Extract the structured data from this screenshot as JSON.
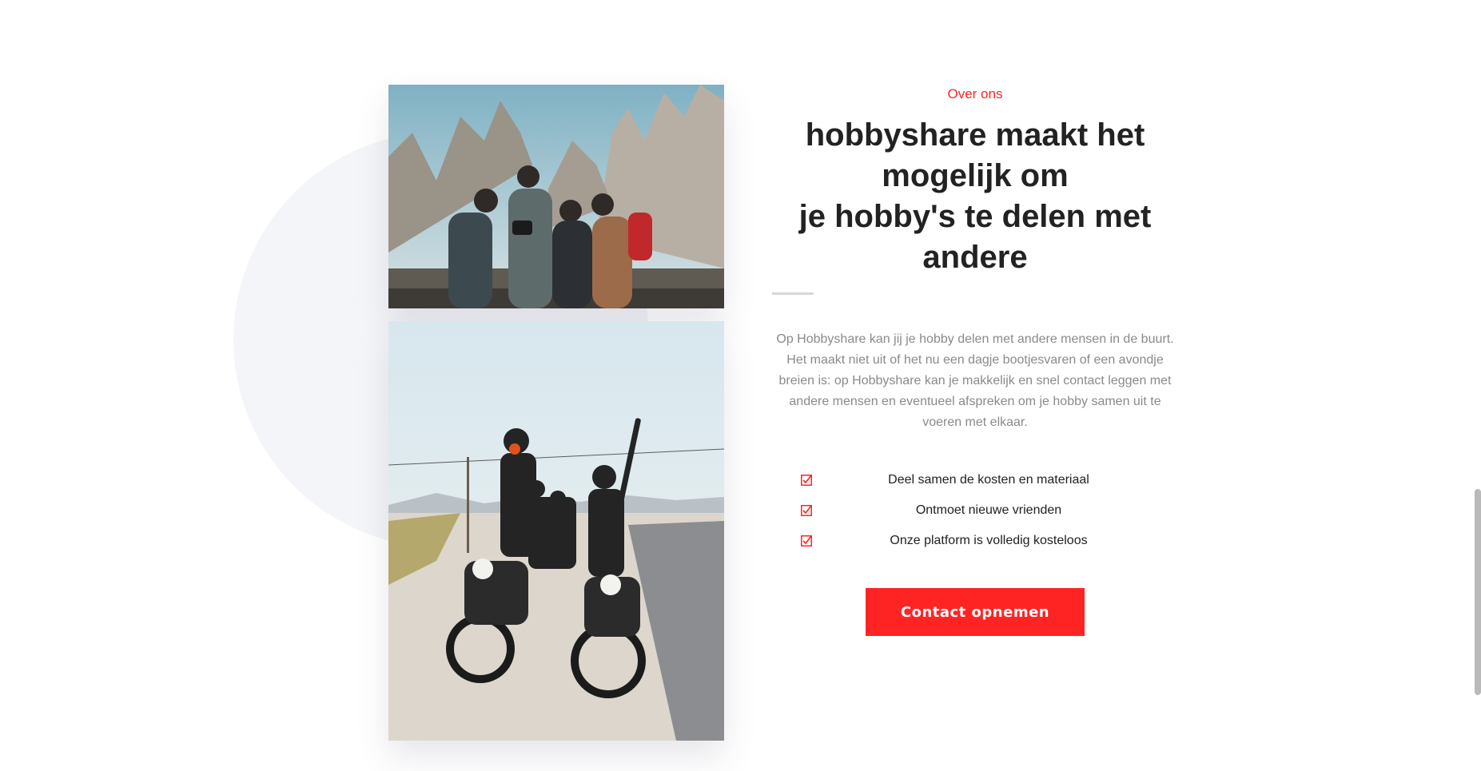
{
  "about": {
    "eyebrow": "Over ons",
    "title_lines": [
      "hobbyshare maakt het",
      "mogelijk om",
      "je hobby's te delen met",
      "andere"
    ],
    "intro": "Op Hobbyshare kan jij je hobby delen met andere mensen in de buurt. Het maakt niet uit of het nu een dagje bootjesvaren of een avondje breien is: op Hobbyshare kan je makkelijk en snel contact leggen met andere mensen en eventueel afspreken om je hobby samen uit te voeren met elkaar.",
    "features": [
      {
        "label": "Deel samen de kosten en materiaal",
        "icon": "checked-box-icon"
      },
      {
        "label": "Ontmoet nieuwe vrienden",
        "icon": "checked-box-icon"
      },
      {
        "label": "Onze platform is volledig kosteloos",
        "icon": "checked-box-icon"
      }
    ],
    "cta_label": "Contact opnemen"
  },
  "images": {
    "top": "group-of-hikers-photo",
    "bottom": "motorcycle-riders-photo"
  },
  "colors": {
    "accent": "#ff2424",
    "heading": "#222222",
    "body_text": "#8a8a8a",
    "background_shape": "#f4f5f8"
  }
}
